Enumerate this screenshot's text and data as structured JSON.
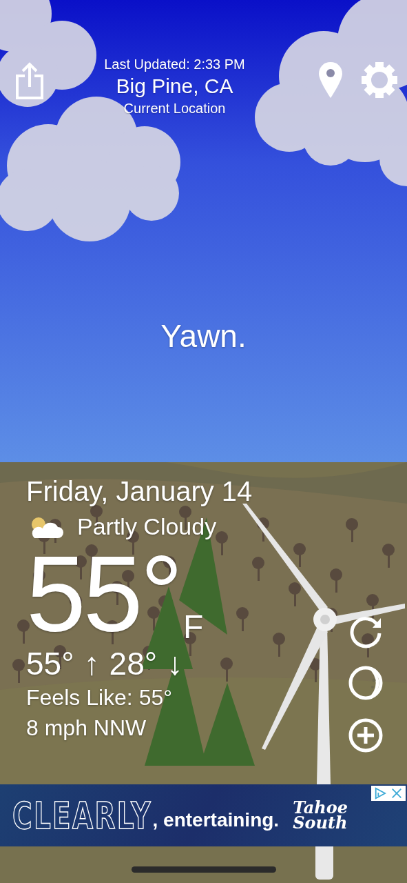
{
  "header": {
    "last_updated": "Last Updated: 2:33 PM",
    "location": "Big Pine, CA",
    "location_note": "Current Location"
  },
  "message": "Yawn.",
  "weather": {
    "date": "Friday, January 14",
    "condition": "Partly Cloudy",
    "temperature": "55°",
    "unit": "F",
    "high": "55°",
    "high_arrow": "↑",
    "low": "28°",
    "low_arrow": "↓",
    "feels_like": "Feels Like: 55°",
    "wind": "8 mph NNW"
  },
  "ad": {
    "headline": "CLEARLY",
    "tagline": ", entertaining.",
    "brand_line_1": "Tahoe",
    "brand_line_2": "South"
  }
}
